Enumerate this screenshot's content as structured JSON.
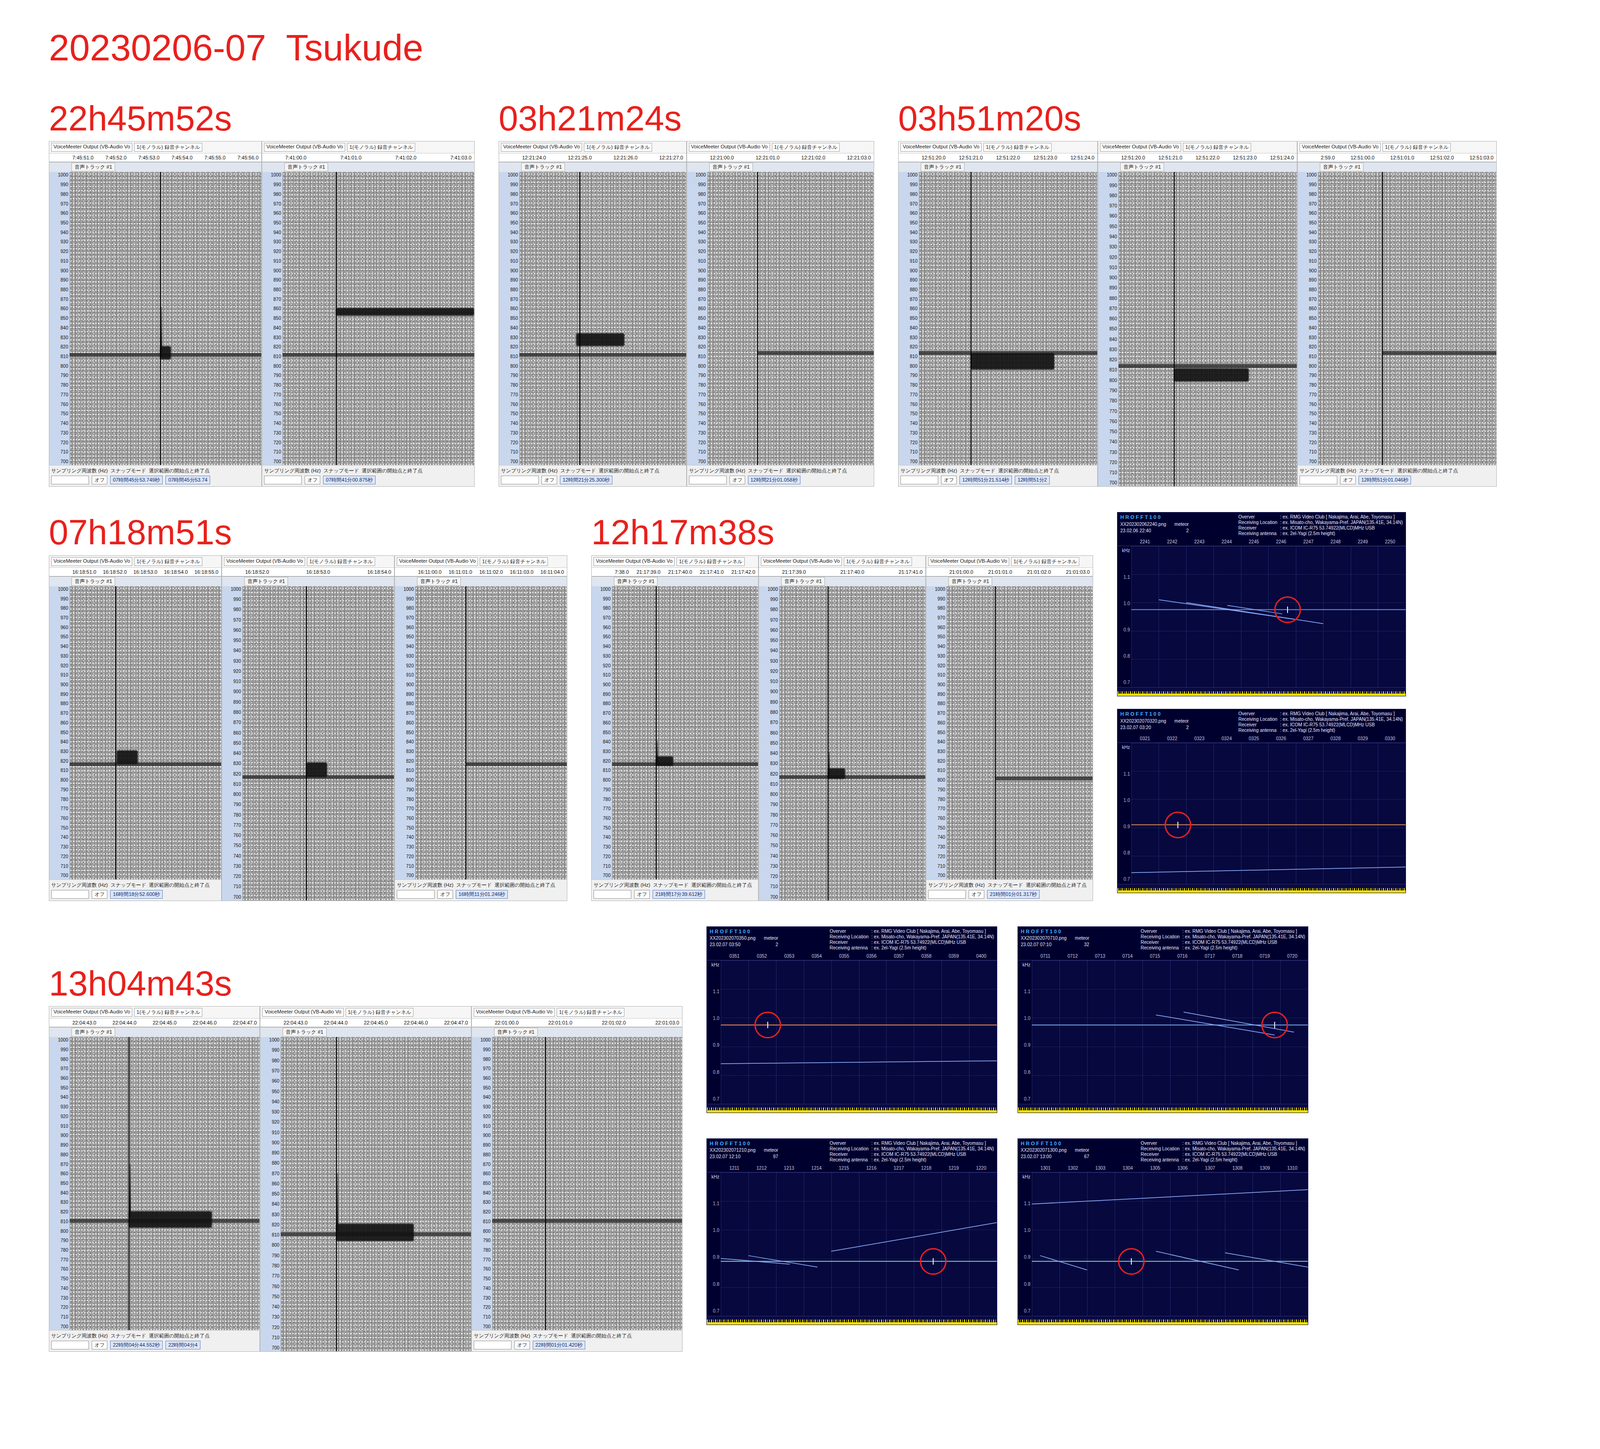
{
  "title": "20230206-07  Tsukude",
  "common": {
    "device": "VoiceMeeter Output (VB-Audio Vo",
    "channel": "1(モノラル) 録音チャンネル",
    "track": "音声トラック #1",
    "axis_ticks": [
      "1000",
      "990",
      "980",
      "970",
      "960",
      "950",
      "940",
      "930",
      "920",
      "910",
      "900",
      "890",
      "880",
      "870",
      "860",
      "850",
      "840",
      "830",
      "820",
      "810",
      "800",
      "790",
      "780",
      "770",
      "760",
      "750",
      "740",
      "730",
      "720",
      "710",
      "700"
    ],
    "footer_labels": [
      "サンプリング周波数 (Hz)",
      "スナップモード",
      "選択範囲の開始点と終了点"
    ],
    "snap_value": "オフ"
  },
  "hrofft_common": {
    "title": "H R O F F T 1 0 0",
    "kind_label": "meteor",
    "unit": "kHz",
    "y_ticks": [
      "1.1",
      "1.0",
      "0.9",
      "0.8",
      "0.7"
    ],
    "info": [
      {
        "key": "Overver",
        "value": ": ex. RMG Video Club [ Nakajima, Arai, Abe, Toyomasu ]"
      },
      {
        "key": "Receiving Location",
        "value": ": ex. Misato-cho, Wakayama-Pref. JAPAN(135.41E, 34.14N)"
      },
      {
        "key": "Receiver",
        "value": ": ex. ICOM IC-R75 53.74922(MLCD)MHz USB"
      },
      {
        "key": "Receiving antenna",
        "value": ": ex. 2el-Yagi (2.5m height)"
      }
    ]
  },
  "rows": [
    {
      "sections": [
        {
          "label": "22h45m52s",
          "panels": [
            {
              "ticks": [
                "7:45:51.0",
                "7:45:52.0",
                "7:45:53.0",
                "7:45:54.0",
                "7:45:55.0",
                "7:45:56.0"
              ],
              "cursor": 0.47,
              "carrier": 813,
              "carrier_start": 0,
              "echoes": [
                {
                  "kind": "head",
                  "start": 0.47,
                  "end": 0.5,
                  "high": 862,
                  "low": 812
                },
                {
                  "kind": "blob",
                  "start": 0.47,
                  "end": 0.53,
                  "high": 822,
                  "low": 808
                }
              ],
              "footer": true,
              "selection": [
                "07時間45分53.749秒",
                "07時間45分53.74"
              ]
            },
            {
              "ticks": [
                "7:41:00.0",
                "7:41:01.0",
                "7:41:02.0",
                "7:41:03.0"
              ],
              "cursor": 0.28,
              "carrier": 813,
              "carrier_start": 0,
              "echoes": [
                {
                  "kind": "line",
                  "start": 0.28,
                  "end": 1,
                  "high": 861,
                  "low": 853
                }
              ],
              "footer": true,
              "selection": [
                "07時間41分00.875秒"
              ]
            }
          ]
        },
        {
          "label": "03h21m24s",
          "panels": [
            {
              "ticks": [
                "12:21:24.0",
                "12:21:25.0",
                "12:21:26.0",
                "12:21:27.0"
              ],
              "cursor": 0.36,
              "carrier": 813,
              "carrier_start": 0,
              "echoes": [
                {
                  "kind": "blob",
                  "start": 0.34,
                  "end": 0.63,
                  "high": 835,
                  "low": 822
                }
              ],
              "footer": true,
              "selection": [
                "12時間21分25.300秒"
              ]
            },
            {
              "ticks": [
                "12:21:00.0",
                "12:21:01.0",
                "12:21:02.0",
                "12:21:03.0"
              ],
              "cursor": 0.3,
              "carrier": 815,
              "carrier_start": 0.3,
              "echoes": [],
              "footer": true,
              "selection": [
                "12時間21分01.058秒"
              ]
            }
          ]
        },
        {
          "label": "03h51m20s",
          "panels": [
            {
              "ticks": [
                "12:51:20.0",
                "12:51:21.0",
                "12:51:22.0",
                "12:51:23.0",
                "12:51:24.0"
              ],
              "cursor": 0.29,
              "carrier": 815,
              "carrier_start": 0,
              "echoes": [
                {
                  "kind": "blob",
                  "start": 0.29,
                  "end": 0.76,
                  "high": 815,
                  "low": 798
                }
              ],
              "footer": true,
              "selection": [
                "12時間51分21.514秒",
                "12時間51分2"
              ]
            },
            {
              "ticks": [
                "12:51:20.0",
                "12:51:21.0",
                "12:51:22.0",
                "12:51:23.0",
                "12:51:24.0"
              ],
              "cursor": 0.31,
              "carrier": 815,
              "carrier_start": 0,
              "echoes": [
                {
                  "kind": "blob",
                  "start": 0.31,
                  "end": 0.73,
                  "high": 813,
                  "low": 800
                }
              ],
              "footer": false,
              "selection": []
            },
            {
              "ticks": [
                "2:59.0",
                "12:51:00.0",
                "12:51:01.0",
                "12:51:02.0",
                "12:51:03.0"
              ],
              "cursor": 0.36,
              "carrier": 815,
              "carrier_start": 0.36,
              "echoes": [],
              "footer": true,
              "selection": [
                "12時間51分01.046秒"
              ]
            }
          ]
        }
      ],
      "hrofft": []
    },
    {
      "sections": [
        {
          "label": "07h18m51s",
          "panels": [
            {
              "ticks": [
                "16:18:51.0",
                "16:18:52.0",
                "16:18:53.0",
                "16:18:54.0",
                "16:18:55.0"
              ],
              "cursor": 0.3,
              "carrier": 818,
              "carrier_start": 0,
              "echoes": [
                {
                  "kind": "blob",
                  "start": 0.31,
                  "end": 0.45,
                  "high": 832,
                  "low": 818
                }
              ],
              "footer": true,
              "selection": [
                "16時間18分52.600秒"
              ]
            },
            {
              "ticks": [
                "16:18:52.0",
                "16:18:53.0",
                "16:18:54.0"
              ],
              "cursor": 0.42,
              "carrier": 818,
              "carrier_start": 0,
              "echoes": [
                {
                  "kind": "blob",
                  "start": 0.42,
                  "end": 0.56,
                  "high": 832,
                  "low": 818
                }
              ],
              "footer": false,
              "selection": []
            },
            {
              "ticks": [
                "16:11:00.0",
                "16:11:01.0",
                "16:11:02.0",
                "16:11:03.0",
                "16:11:04.0"
              ],
              "cursor": 0.33,
              "carrier": 818,
              "carrier_start": 0.33,
              "echoes": [],
              "footer": true,
              "selection": [
                "16時間11分01.246秒"
              ]
            }
          ]
        },
        {
          "label": "12h17m38s",
          "panels": [
            {
              "ticks": [
                "7:38.0",
                "21:17:39.0",
                "21:17:40.0",
                "21:17:41.0",
                "21:17:42.0"
              ],
              "cursor": 0.3,
              "carrier": 818,
              "carrier_start": 0,
              "echoes": [
                {
                  "kind": "head",
                  "start": 0.3,
                  "end": 0.33,
                  "high": 842,
                  "low": 818
                },
                {
                  "kind": "blob",
                  "start": 0.3,
                  "end": 0.42,
                  "high": 826,
                  "low": 816
                }
              ],
              "footer": true,
              "selection": [
                "21時間17分39.612秒"
              ]
            },
            {
              "ticks": [
                "21:17:39.0",
                "21:17:40.0",
                "21:17:41.0"
              ],
              "cursor": 0.33,
              "carrier": 818,
              "carrier_start": 0,
              "echoes": [
                {
                  "kind": "head",
                  "start": 0.33,
                  "end": 0.36,
                  "high": 842,
                  "low": 818
                },
                {
                  "kind": "blob",
                  "start": 0.33,
                  "end": 0.45,
                  "high": 826,
                  "low": 816
                }
              ],
              "footer": false,
              "selection": []
            },
            {
              "ticks": [
                "21:01:00.0",
                "21:01:01.0",
                "21:01:02.0",
                "21:01:03.0"
              ],
              "cursor": 0.33,
              "carrier": 803,
              "carrier_start": 0.33,
              "echoes": [],
              "footer": true,
              "selection": [
                "21時間01分01.317秒"
              ]
            }
          ]
        }
      ],
      "hrofft": [
        {
          "filename": "XX202302062240.png",
          "date": "23.02.06 22:40",
          "count": "2",
          "ticks": [
            "2241",
            "2242",
            "2243",
            "2244",
            "2245",
            "2246",
            "2247",
            "2248",
            "2249",
            "2250"
          ],
          "circle": {
            "x": 57,
            "y": 45
          },
          "baseline": {
            "y": 45,
            "color": "#5a8ad8"
          },
          "traces": [
            [
              10,
              38,
              60,
              52
            ],
            [
              20,
              40,
              70,
              55
            ],
            [
              35,
              42,
              55,
              48
            ]
          ]
        },
        {
          "filename": "XX202302070320.png",
          "date": "23.02.07 03:20",
          "count": "2",
          "ticks": [
            "0321",
            "0322",
            "0323",
            "0324",
            "0325",
            "0326",
            "0327",
            "0328",
            "0329",
            "0330"
          ],
          "circle": {
            "x": 17,
            "y": 58
          },
          "baseline": {
            "y": 58,
            "color": "#d08050"
          },
          "traces": [
            [
              0,
              92,
              100,
              88
            ]
          ]
        }
      ]
    },
    {
      "sections": [
        {
          "label": "13h04m43s",
          "panels": [
            {
              "ticks": [
                "22:04:43.0",
                "22:04:44.0",
                "22:04:45.0",
                "22:04:46.0",
                "22:04:47.0"
              ],
              "cursor": 0.31,
              "carrier": 812,
              "carrier_start": 0,
              "echoes": [
                {
                  "kind": "head",
                  "start": 0.31,
                  "end": 0.34,
                  "high": 870,
                  "low": 815
                },
                {
                  "kind": "blob",
                  "start": 0.31,
                  "end": 0.75,
                  "high": 822,
                  "low": 805
                }
              ],
              "footer": true,
              "selection": [
                "22時間04分44.552秒",
                "22時間04分4"
              ]
            },
            {
              "ticks": [
                "22:04:43.0",
                "22:04:44.0",
                "22:04:45.0",
                "22:04:46.0",
                "22:04:47.0"
              ],
              "cursor": 0.29,
              "carrier": 812,
              "carrier_start": 0,
              "echoes": [
                {
                  "kind": "head",
                  "start": 0.29,
                  "end": 0.32,
                  "high": 870,
                  "low": 815
                },
                {
                  "kind": "blob",
                  "start": 0.29,
                  "end": 0.7,
                  "high": 822,
                  "low": 805
                }
              ],
              "footer": false,
              "selection": []
            },
            {
              "ticks": [
                "22:01:00.0",
                "22:01:01.0",
                "22:01:02.0",
                "22:01:03.0"
              ],
              "cursor": 0.28,
              "carrier": 812,
              "carrier_start": 0,
              "echoes": [],
              "footer": true,
              "selection": [
                "22時間01分01.420秒"
              ]
            }
          ]
        }
      ],
      "hrofft": [
        {
          "filename": "XX202302070350.png",
          "date": "23.02.07 03:50",
          "count": "2",
          "ticks": [
            "0351",
            "0352",
            "0353",
            "0354",
            "0355",
            "0356",
            "0357",
            "0358",
            "0359",
            "0400"
          ],
          "circle": {
            "x": 17,
            "y": 45
          },
          "baseline": {
            "y": 45,
            "color": "#d08050"
          },
          "traces": [
            [
              0,
              72,
              100,
              70
            ]
          ]
        },
        {
          "filename": "XX202302070710.png",
          "date": "23.02.07 07:10",
          "count": "32",
          "ticks": [
            "0711",
            "0712",
            "0713",
            "0714",
            "0715",
            "0716",
            "0717",
            "0718",
            "0719",
            "0720"
          ],
          "circle": {
            "x": 88,
            "y": 45
          },
          "baseline": {
            "y": 45,
            "color": "#6a9ae0"
          },
          "traces": [
            [
              45,
              38,
              88,
              52
            ],
            [
              55,
              36,
              95,
              50
            ]
          ]
        },
        {
          "filename": "XX202302071210.png",
          "date": "23.02.07 12:10",
          "count": "97",
          "ticks": [
            "1211",
            "1212",
            "1213",
            "1214",
            "1215",
            "1216",
            "1217",
            "1218",
            "1219",
            "1220"
          ],
          "circle": {
            "x": 77,
            "y": 62
          },
          "baseline": {
            "y": 62,
            "color": "#7ac8a8"
          },
          "traces": [
            [
              0,
              60,
              25,
              64
            ],
            [
              10,
              58,
              35,
              66
            ],
            [
              40,
              55,
              100,
              35
            ]
          ]
        },
        {
          "filename": "XX202302071300.png",
          "date": "23.02.07 13:00",
          "count": "67",
          "ticks": [
            "1301",
            "1302",
            "1303",
            "1304",
            "1305",
            "1306",
            "1307",
            "1308",
            "1309",
            "1310"
          ],
          "circle": {
            "x": 36,
            "y": 62
          },
          "baseline": {
            "y": 62,
            "color": "#7ac8a8"
          },
          "traces": [
            [
              0,
              22,
              100,
              12
            ],
            [
              3,
              58,
              20,
              68
            ],
            [
              45,
              55,
              75,
              68
            ],
            [
              70,
              56,
              100,
              66
            ]
          ]
        }
      ]
    }
  ]
}
